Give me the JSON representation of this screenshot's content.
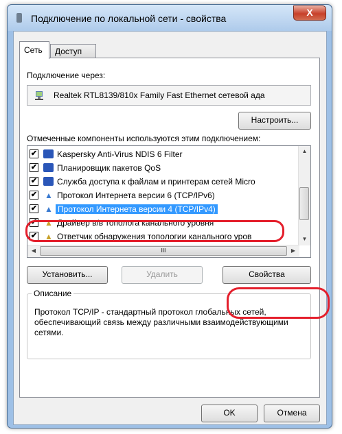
{
  "window": {
    "title": "Подключение по локальной сети - свойства",
    "close_glyph": "X"
  },
  "tabs": [
    {
      "label": "Сеть",
      "active": true
    },
    {
      "label": "Доступ",
      "active": false
    }
  ],
  "connection": {
    "label": "Подключение через:",
    "adapter": "Realtek RTL8139/810x Family Fast Ethernet сетевой ада",
    "configure_button": "Настроить..."
  },
  "components": {
    "label": "Отмеченные компоненты используются этим подключением:",
    "items": [
      {
        "label": "Kaspersky Anti-Virus NDIS 6 Filter",
        "checked": true,
        "icon": "network-component-icon",
        "selected": false
      },
      {
        "label": "Планировщик пакетов QoS",
        "checked": true,
        "icon": "network-component-icon",
        "selected": false
      },
      {
        "label": "Служба доступа к файлам и принтерам сетей Micro",
        "checked": true,
        "icon": "network-component-icon",
        "selected": false
      },
      {
        "label": "Протокол Интернета версии 6 (TCP/IPv6)",
        "checked": true,
        "icon": "protocol-icon",
        "selected": false
      },
      {
        "label": "Протокол Интернета версии 4 (TCP/IPv4)",
        "checked": true,
        "icon": "protocol-icon",
        "selected": true
      },
      {
        "label": "Драйвер в/в тополога канального уровня",
        "checked": true,
        "icon": "protocol-icon",
        "selected": false
      },
      {
        "label": "Ответчик обнаружения топологии канального уров",
        "checked": true,
        "icon": "protocol-icon",
        "selected": false
      }
    ],
    "checkmark": "✔",
    "scroll_glyph": "III"
  },
  "actions": {
    "install": "Установить...",
    "remove": "Удалить",
    "properties": "Свойства"
  },
  "description": {
    "legend": "Описание",
    "text": "Протокол TCP/IP - стандартный протокол глобальных сетей, обеспечивающий связь между различными взаимодействующими сетями."
  },
  "footer": {
    "ok": "OK",
    "cancel": "Отмена"
  },
  "colors": {
    "highlight": "#3399ff",
    "annotation": "#e41f2c",
    "title_bar": "#aecbeb"
  }
}
